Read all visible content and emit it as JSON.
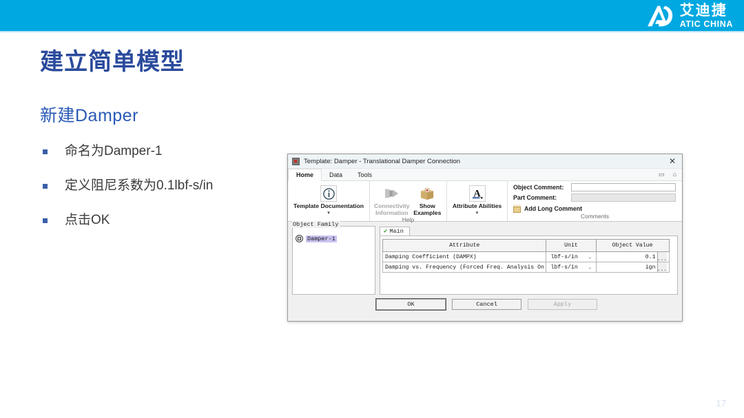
{
  "slide": {
    "title": "建立简单模型",
    "subtitle": "新建Damper",
    "bullets": [
      "命名为Damper-1",
      "定义阻尼系数为0.1lbf-s/in",
      "点击OK"
    ],
    "page_number": "17",
    "accent_top": "#00a8e1",
    "title_color": "#2a4a9c"
  },
  "logo": {
    "cn": "艾迪捷",
    "en": "ATIC CHINA",
    "mark": "ad-monogram-icon"
  },
  "dialog": {
    "titlebar": {
      "icon": "application-icon",
      "text": "Template: Damper - Translational Damper Connection",
      "close": "✕"
    },
    "tabs": [
      {
        "label": "Home",
        "active": true
      },
      {
        "label": "Data",
        "active": false
      },
      {
        "label": "Tools",
        "active": false
      }
    ],
    "ribbon_controls": {
      "minimize": "▭",
      "chevron": "⌂"
    },
    "ribbon": {
      "documentation": {
        "label": "Template Documentation",
        "icon": "info-circle-icon",
        "caret": "▾",
        "disabled": false
      },
      "help_group": {
        "label": "Help",
        "buttons": [
          {
            "label": "Connectivity Information",
            "icon": "connectivity-icon",
            "disabled": true
          },
          {
            "label": "Show Examples",
            "icon": "open-box-icon",
            "disabled": false
          }
        ]
      },
      "attribute_abilities": {
        "label": "Attribute Abilities",
        "icon": "letter-a-icon",
        "caret": "▾"
      },
      "comments": {
        "group_label": "Comments",
        "object_comment_label": "Object Comment:",
        "object_comment_value": "",
        "part_comment_label": "Part Comment:",
        "part_comment_value": "",
        "add_long_comment_label": "Add Long Comment",
        "note_icon": "note-icon"
      }
    },
    "tree": {
      "title": "Object Family",
      "items": [
        {
          "label": "Damper-1",
          "icon": "object-node-icon",
          "selected": true
        }
      ]
    },
    "data_tab": {
      "label": "Main",
      "check": "✔"
    },
    "table": {
      "headers": [
        "Attribute",
        "Unit",
        "Object Value"
      ],
      "rows": [
        {
          "attribute": "Damping Coefficient (DAMPX)",
          "unit": "lbf-s/in",
          "unit_caret": "⌄",
          "value": "0.1",
          "ellipsis": "..."
        },
        {
          "attribute": "Damping vs. Frequency (Forced Freq. Analysis On...",
          "unit": "lbf-s/in",
          "unit_caret": "⌄",
          "value": "ign",
          "ellipsis": "..."
        }
      ]
    },
    "buttons": [
      {
        "label": "OK",
        "state": "default"
      },
      {
        "label": "Cancel",
        "state": "normal"
      },
      {
        "label": "Apply",
        "state": "disabled"
      }
    ]
  }
}
